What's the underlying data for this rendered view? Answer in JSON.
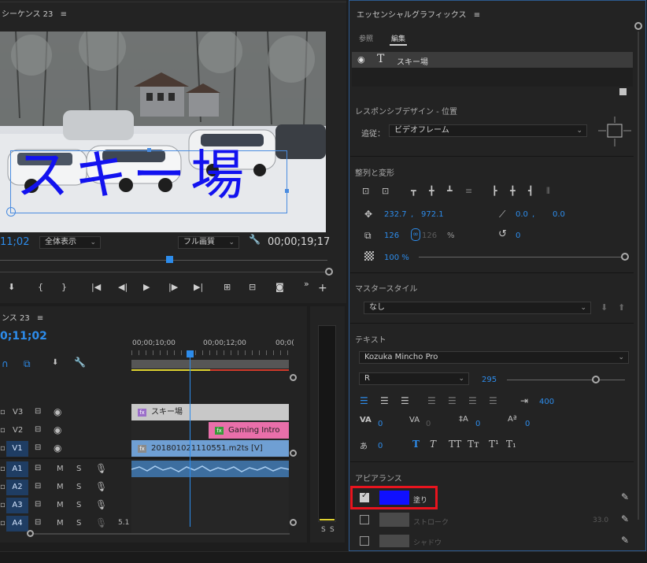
{
  "program": {
    "title": "シーケンス 23",
    "timecode_left": "11;02",
    "fit_label": "全体表示",
    "quality_label": "フル画質",
    "timecode_right": "00;00;19;17",
    "caption_text": "スキー場"
  },
  "timeline": {
    "title": "ンス 23",
    "timecode": "0;11;02",
    "ruler": [
      "00;00;10;00",
      "00;00;12;00",
      "00;0("
    ],
    "tracks": [
      {
        "id": "V3",
        "selected": false
      },
      {
        "id": "V2",
        "selected": false
      },
      {
        "id": "V1",
        "selected": true
      },
      {
        "id": "A1",
        "selected": true
      },
      {
        "id": "A2",
        "selected": true
      },
      {
        "id": "A3",
        "selected": true
      },
      {
        "id": "A4",
        "selected": true
      }
    ],
    "mute_label": "M",
    "solo_label": "S",
    "clips": {
      "v3": "スキー場",
      "v2": "Gaming Intro",
      "v1": "201801021110551.m2ts [V]"
    },
    "extra_label": "5.1",
    "meter_labels": [
      "S",
      "S"
    ]
  },
  "eg": {
    "title": "エッセンシャルグラフィックス",
    "tabs": [
      "参照",
      "編集"
    ],
    "layer_name": "スキー場",
    "responsive": {
      "section": "レスポンシブデザイン - 位置",
      "follow_label": "追従：",
      "follow_value": "ビデオフレーム"
    },
    "align": {
      "section": "整列と変形",
      "pos_x": "232.7",
      "pos_y": "972.1",
      "anchor_x": "0.0",
      "anchor_y": "0.0",
      "scale_w": "126",
      "scale_h": "126",
      "pct": "%",
      "rotation": "0",
      "opacity": "100 %"
    },
    "master": {
      "section": "マスタースタイル",
      "value": "なし"
    },
    "text": {
      "section": "テキスト",
      "font": "Kozuka Mincho Pro",
      "style": "R",
      "size": "295",
      "tab_width": "400",
      "tracking": "0",
      "kerning": "0",
      "leading": "0",
      "baseline": "0",
      "tsume": "0"
    },
    "appearance": {
      "section": "アピアランス",
      "fill_label": "塗り",
      "fill_color": "#1010ff",
      "stroke_label": "ストローク",
      "stroke_value": "33.0",
      "shadow_label": "シャドウ"
    }
  },
  "colors": {
    "accent": "#2d8ceb",
    "highlight_box": "#e8141e",
    "clip_gray": "#c8c8c8",
    "clip_pink": "#e96faa",
    "clip_blue": "#6f9fd3"
  }
}
